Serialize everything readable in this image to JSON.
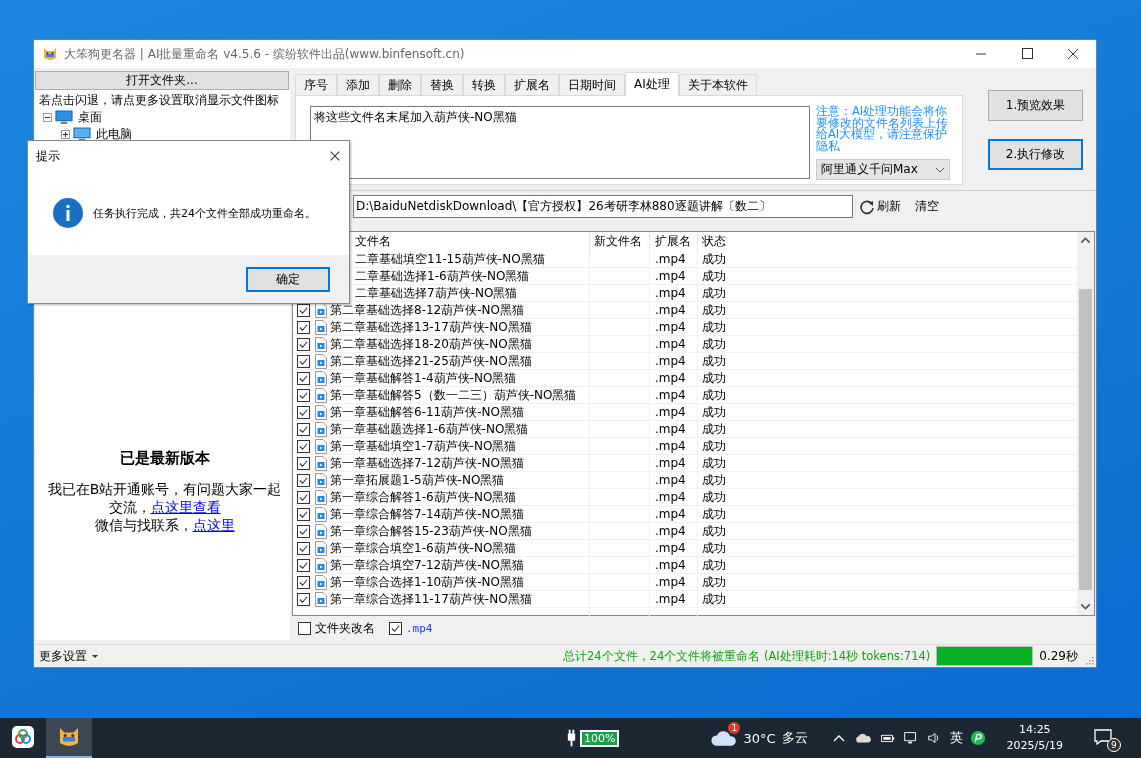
{
  "window": {
    "title": "大笨狗更名器 | AI批量重命名 v4.5.6 - 缤纷软件出品(www.binfensoft.cn)"
  },
  "left_panel": {
    "open_folder_button": "打开文件夹...",
    "hint": "若点击闪退，请点更多设置取消显示文件图标",
    "tree": [
      {
        "label": "桌面",
        "expanded": true,
        "children": [
          {
            "label": "此电脑",
            "expanded": false
          }
        ]
      }
    ],
    "update_title": "已是最新版本",
    "contact_lines": [
      {
        "text": "我已在B站开通账号，有问题大家一起交流，",
        "link": "点这里查看"
      },
      {
        "text": "微信与找联系，",
        "link": "点这里"
      }
    ]
  },
  "tabs": [
    {
      "label": "序号",
      "selected": false
    },
    {
      "label": "添加",
      "selected": false
    },
    {
      "label": "删除",
      "selected": false
    },
    {
      "label": "替换",
      "selected": false
    },
    {
      "label": "转换",
      "selected": false
    },
    {
      "label": "扩展名",
      "selected": false
    },
    {
      "label": "日期时间",
      "selected": false
    },
    {
      "label": "AI处理",
      "selected": true
    },
    {
      "label": "关于本软件",
      "selected": false
    }
  ],
  "ai_panel": {
    "prompt": "将这些文件名末尾加入葫芦侠-NO黑猫",
    "notice": "注意：AI处理功能会将你要修改的文件名列表上传给AI大模型，请注意保护隐私",
    "model": "阿里通义千问Max"
  },
  "actions": [
    {
      "label": "1.预览效果",
      "focused": false
    },
    {
      "label": "2.执行修改",
      "focused": true
    }
  ],
  "path_bar": {
    "path": "D:\\BaiduNetdiskDownload\\【官方授权】26考研李林880逐题讲解〔数二〕",
    "refresh": "刷新",
    "clear": "清空"
  },
  "table": {
    "columns": [
      "文件名",
      "新文件名",
      "扩展名",
      "状态"
    ],
    "rows": [
      {
        "name": "二章基础填空11-15葫芦侠-NO黑猫",
        "ext": ".mp4",
        "status": "成功"
      },
      {
        "name": "二章基础选择1-6葫芦侠-NO黑猫",
        "ext": ".mp4",
        "status": "成功"
      },
      {
        "name": "二章基础选择7葫芦侠-NO黑猫",
        "ext": ".mp4",
        "status": "成功"
      },
      {
        "name": "第二章基础选择8-12葫芦侠-NO黑猫",
        "ext": ".mp4",
        "status": "成功",
        "checked": true
      },
      {
        "name": "第二章基础选择13-17葫芦侠-NO黑猫",
        "ext": ".mp4",
        "status": "成功",
        "checked": true
      },
      {
        "name": "第二章基础选择18-20葫芦侠-NO黑猫",
        "ext": ".mp4",
        "status": "成功",
        "checked": true
      },
      {
        "name": "第二章基础选择21-25葫芦侠-NO黑猫",
        "ext": ".mp4",
        "status": "成功",
        "checked": true
      },
      {
        "name": "第一章基础解答1-4葫芦侠-NO黑猫",
        "ext": ".mp4",
        "status": "成功",
        "checked": true
      },
      {
        "name": "第一章基础解答5（数一二三）葫芦侠-NO黑猫",
        "ext": ".mp4",
        "status": "成功",
        "checked": true
      },
      {
        "name": "第一章基础解答6-11葫芦侠-NO黑猫",
        "ext": ".mp4",
        "status": "成功",
        "checked": true
      },
      {
        "name": "第一章基础题选择1-6葫芦侠-NO黑猫",
        "ext": ".mp4",
        "status": "成功",
        "checked": true
      },
      {
        "name": "第一章基础填空1-7葫芦侠-NO黑猫",
        "ext": ".mp4",
        "status": "成功",
        "checked": true
      },
      {
        "name": "第一章基础选择7-12葫芦侠-NO黑猫",
        "ext": ".mp4",
        "status": "成功",
        "checked": true
      },
      {
        "name": "第一章拓展题1-5葫芦侠-NO黑猫",
        "ext": ".mp4",
        "status": "成功",
        "checked": true
      },
      {
        "name": "第一章综合解答1-6葫芦侠-NO黑猫",
        "ext": ".mp4",
        "status": "成功",
        "checked": true
      },
      {
        "name": "第一章综合解答7-14葫芦侠-NO黑猫",
        "ext": ".mp4",
        "status": "成功",
        "checked": true
      },
      {
        "name": "第一章综合解答15-23葫芦侠-NO黑猫",
        "ext": ".mp4",
        "status": "成功",
        "checked": true
      },
      {
        "name": "第一章综合填空1-6葫芦侠-NO黑猫",
        "ext": ".mp4",
        "status": "成功",
        "checked": true
      },
      {
        "name": "第一章综合填空7-12葫芦侠-NO黑猫",
        "ext": ".mp4",
        "status": "成功",
        "checked": true
      },
      {
        "name": "第一章综合选择1-10葫芦侠-NO黑猫",
        "ext": ".mp4",
        "status": "成功",
        "checked": true
      },
      {
        "name": "第一章综合选择11-17葫芦侠-NO黑猫",
        "ext": ".mp4",
        "status": "成功",
        "checked": true
      }
    ]
  },
  "options": [
    {
      "label": "文件夹改名",
      "checked": false,
      "kind": "plain"
    },
    {
      "label": ".mp4",
      "checked": true,
      "kind": "extension"
    }
  ],
  "status_bar": {
    "menu": "更多设置",
    "message": "总计24个文件，24个文件将被重命名 (AI处理耗时:14秒 tokens:714)",
    "level": 1,
    "elapsed": "0.29秒"
  },
  "dialog": {
    "title": "提示",
    "message": "任务执行完成，共24个文件全部成功重命名。",
    "button": "确定"
  },
  "taskbar": {
    "apps": [
      {
        "kind": "cloud",
        "selected": false
      },
      {
        "kind": "dog",
        "selected": true
      }
    ],
    "battery": "100%",
    "weather_badge": "1",
    "temperature": "30°C",
    "weather": "多云",
    "ime": "英",
    "time": "14:25",
    "date": "2025/5/19",
    "notifications": "9"
  }
}
